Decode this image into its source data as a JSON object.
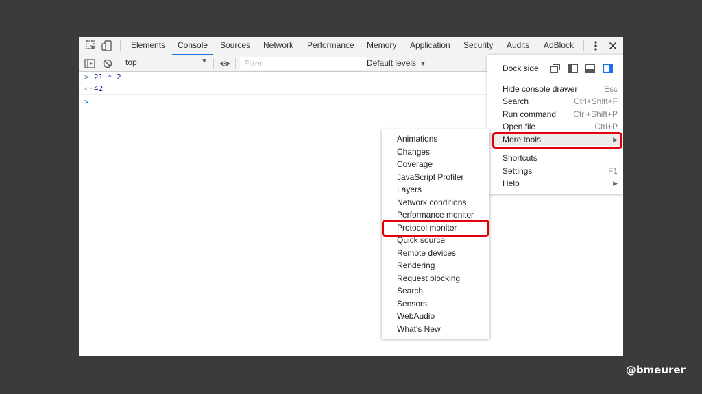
{
  "tabs": [
    {
      "label": "Elements",
      "active": false
    },
    {
      "label": "Console",
      "active": true
    },
    {
      "label": "Sources",
      "active": false
    },
    {
      "label": "Network",
      "active": false
    },
    {
      "label": "Performance",
      "active": false
    },
    {
      "label": "Memory",
      "active": false
    },
    {
      "label": "Application",
      "active": false
    },
    {
      "label": "Security",
      "active": false
    },
    {
      "label": "Audits",
      "active": false
    },
    {
      "label": "AdBlock",
      "active": false
    }
  ],
  "icons": {
    "inspect": "inspect-element-icon",
    "device": "device-toolbar-icon",
    "kebab": "more-options-icon",
    "close": "close-icon",
    "sidebar": "show-sidebar-icon",
    "clear": "clear-console-icon",
    "eye": "live-expression-icon"
  },
  "toolbar": {
    "context": "top",
    "filter_placeholder": "Filter",
    "levels": "Default levels"
  },
  "console": {
    "input": "21 * 2",
    "result": "42"
  },
  "main_menu": {
    "dock_side": "Dock side",
    "items": [
      {
        "label": "Hide console drawer",
        "shortcut": "Esc"
      },
      {
        "label": "Search",
        "shortcut": "Ctrl+Shift+F"
      },
      {
        "label": "Run command",
        "shortcut": "Ctrl+Shift+P"
      },
      {
        "label": "Open file",
        "shortcut": "Ctrl+P"
      },
      {
        "label": "More tools",
        "shortcut": ""
      },
      {
        "label": "Shortcuts",
        "shortcut": ""
      },
      {
        "label": "Settings",
        "shortcut": "F1"
      },
      {
        "label": "Help",
        "shortcut": ""
      }
    ]
  },
  "more_tools": [
    "Animations",
    "Changes",
    "Coverage",
    "JavaScript Profiler",
    "Layers",
    "Network conditions",
    "Performance monitor",
    "Protocol monitor",
    "Quick source",
    "Remote devices",
    "Rendering",
    "Request blocking",
    "Search",
    "Sensors",
    "WebAudio",
    "What's New"
  ],
  "handle": "@bmeurer",
  "colors": {
    "background": "#3b3b3b",
    "accent": "#1a73e8",
    "highlight_box": "#e0000a"
  }
}
